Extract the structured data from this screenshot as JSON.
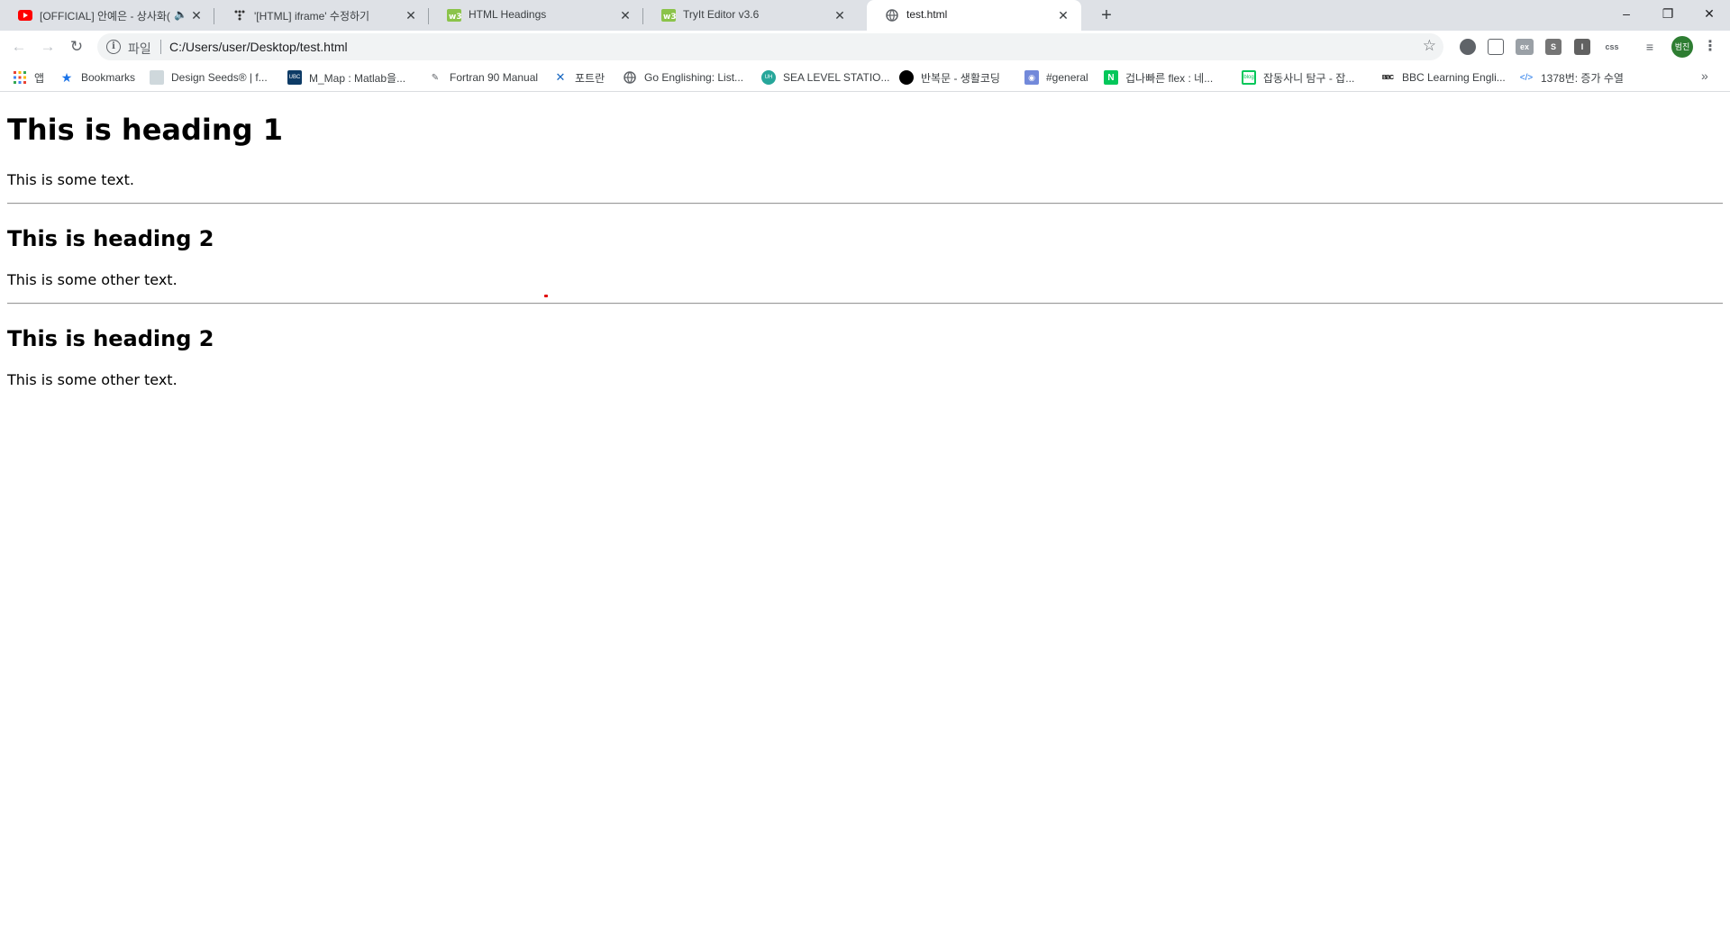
{
  "tabs": [
    {
      "title": "[OFFICIAL] 안예은 - 상사화(",
      "icon": "youtube-icon",
      "audio": true
    },
    {
      "title": "'[HTML] iframe' 수정하기",
      "icon": "velog-icon"
    },
    {
      "title": "HTML Headings",
      "icon": "w3schools-icon"
    },
    {
      "title": "TryIt Editor v3.6",
      "icon": "w3schools-icon"
    },
    {
      "title": "test.html",
      "icon": "globe-icon",
      "active": true
    }
  ],
  "window_controls": {
    "minimize": "–",
    "restore": "❐",
    "close": "✕"
  },
  "toolbar": {
    "back": "←",
    "forward": "→",
    "reload": "↻",
    "scheme_label": "파일",
    "url": "C:/Users/user/Desktop/test.html",
    "star": "☆",
    "ext_s": "S",
    "ext_i": "I",
    "ext_css": "css",
    "ext_ex": "ex",
    "avatar_text": "범진",
    "menu": "⋮"
  },
  "bookmarks": [
    {
      "label": "앱",
      "icon": "apps-grid-icon"
    },
    {
      "label": "Bookmarks",
      "icon": "star-icon"
    },
    {
      "label": "Design Seeds® | f...",
      "icon": "design-seeds-icon"
    },
    {
      "label": "M_Map : Matlab을...",
      "icon": "ubc-icon"
    },
    {
      "label": "Fortran 90 Manual",
      "icon": "fortran-icon"
    },
    {
      "label": "포트란",
      "icon": "cross-icon"
    },
    {
      "label": "Go Englishing: List...",
      "icon": "globe-icon"
    },
    {
      "label": "SEA LEVEL STATIO...",
      "icon": "uh-icon"
    },
    {
      "label": "반복문 - 생활코딩",
      "icon": "black-circle-icon"
    },
    {
      "label": "#general",
      "icon": "discord-icon"
    },
    {
      "label": "겁나빠른 flex : 네...",
      "icon": "naver-icon"
    },
    {
      "label": "잡동사니 탐구 - 잡...",
      "icon": "blog-icon"
    },
    {
      "label": "BBC Learning Engli...",
      "icon": "bbc-icon"
    },
    {
      "label": "1378번: 증가 수열",
      "icon": "code-icon"
    }
  ],
  "bookmarks_more": "»",
  "page": {
    "heading1": "This is heading 1",
    "text1": "This is some text.",
    "heading2a": "This is heading 2",
    "text2": "This is some other text.",
    "heading2b": "This is heading 2",
    "text3": "This is some other text."
  }
}
